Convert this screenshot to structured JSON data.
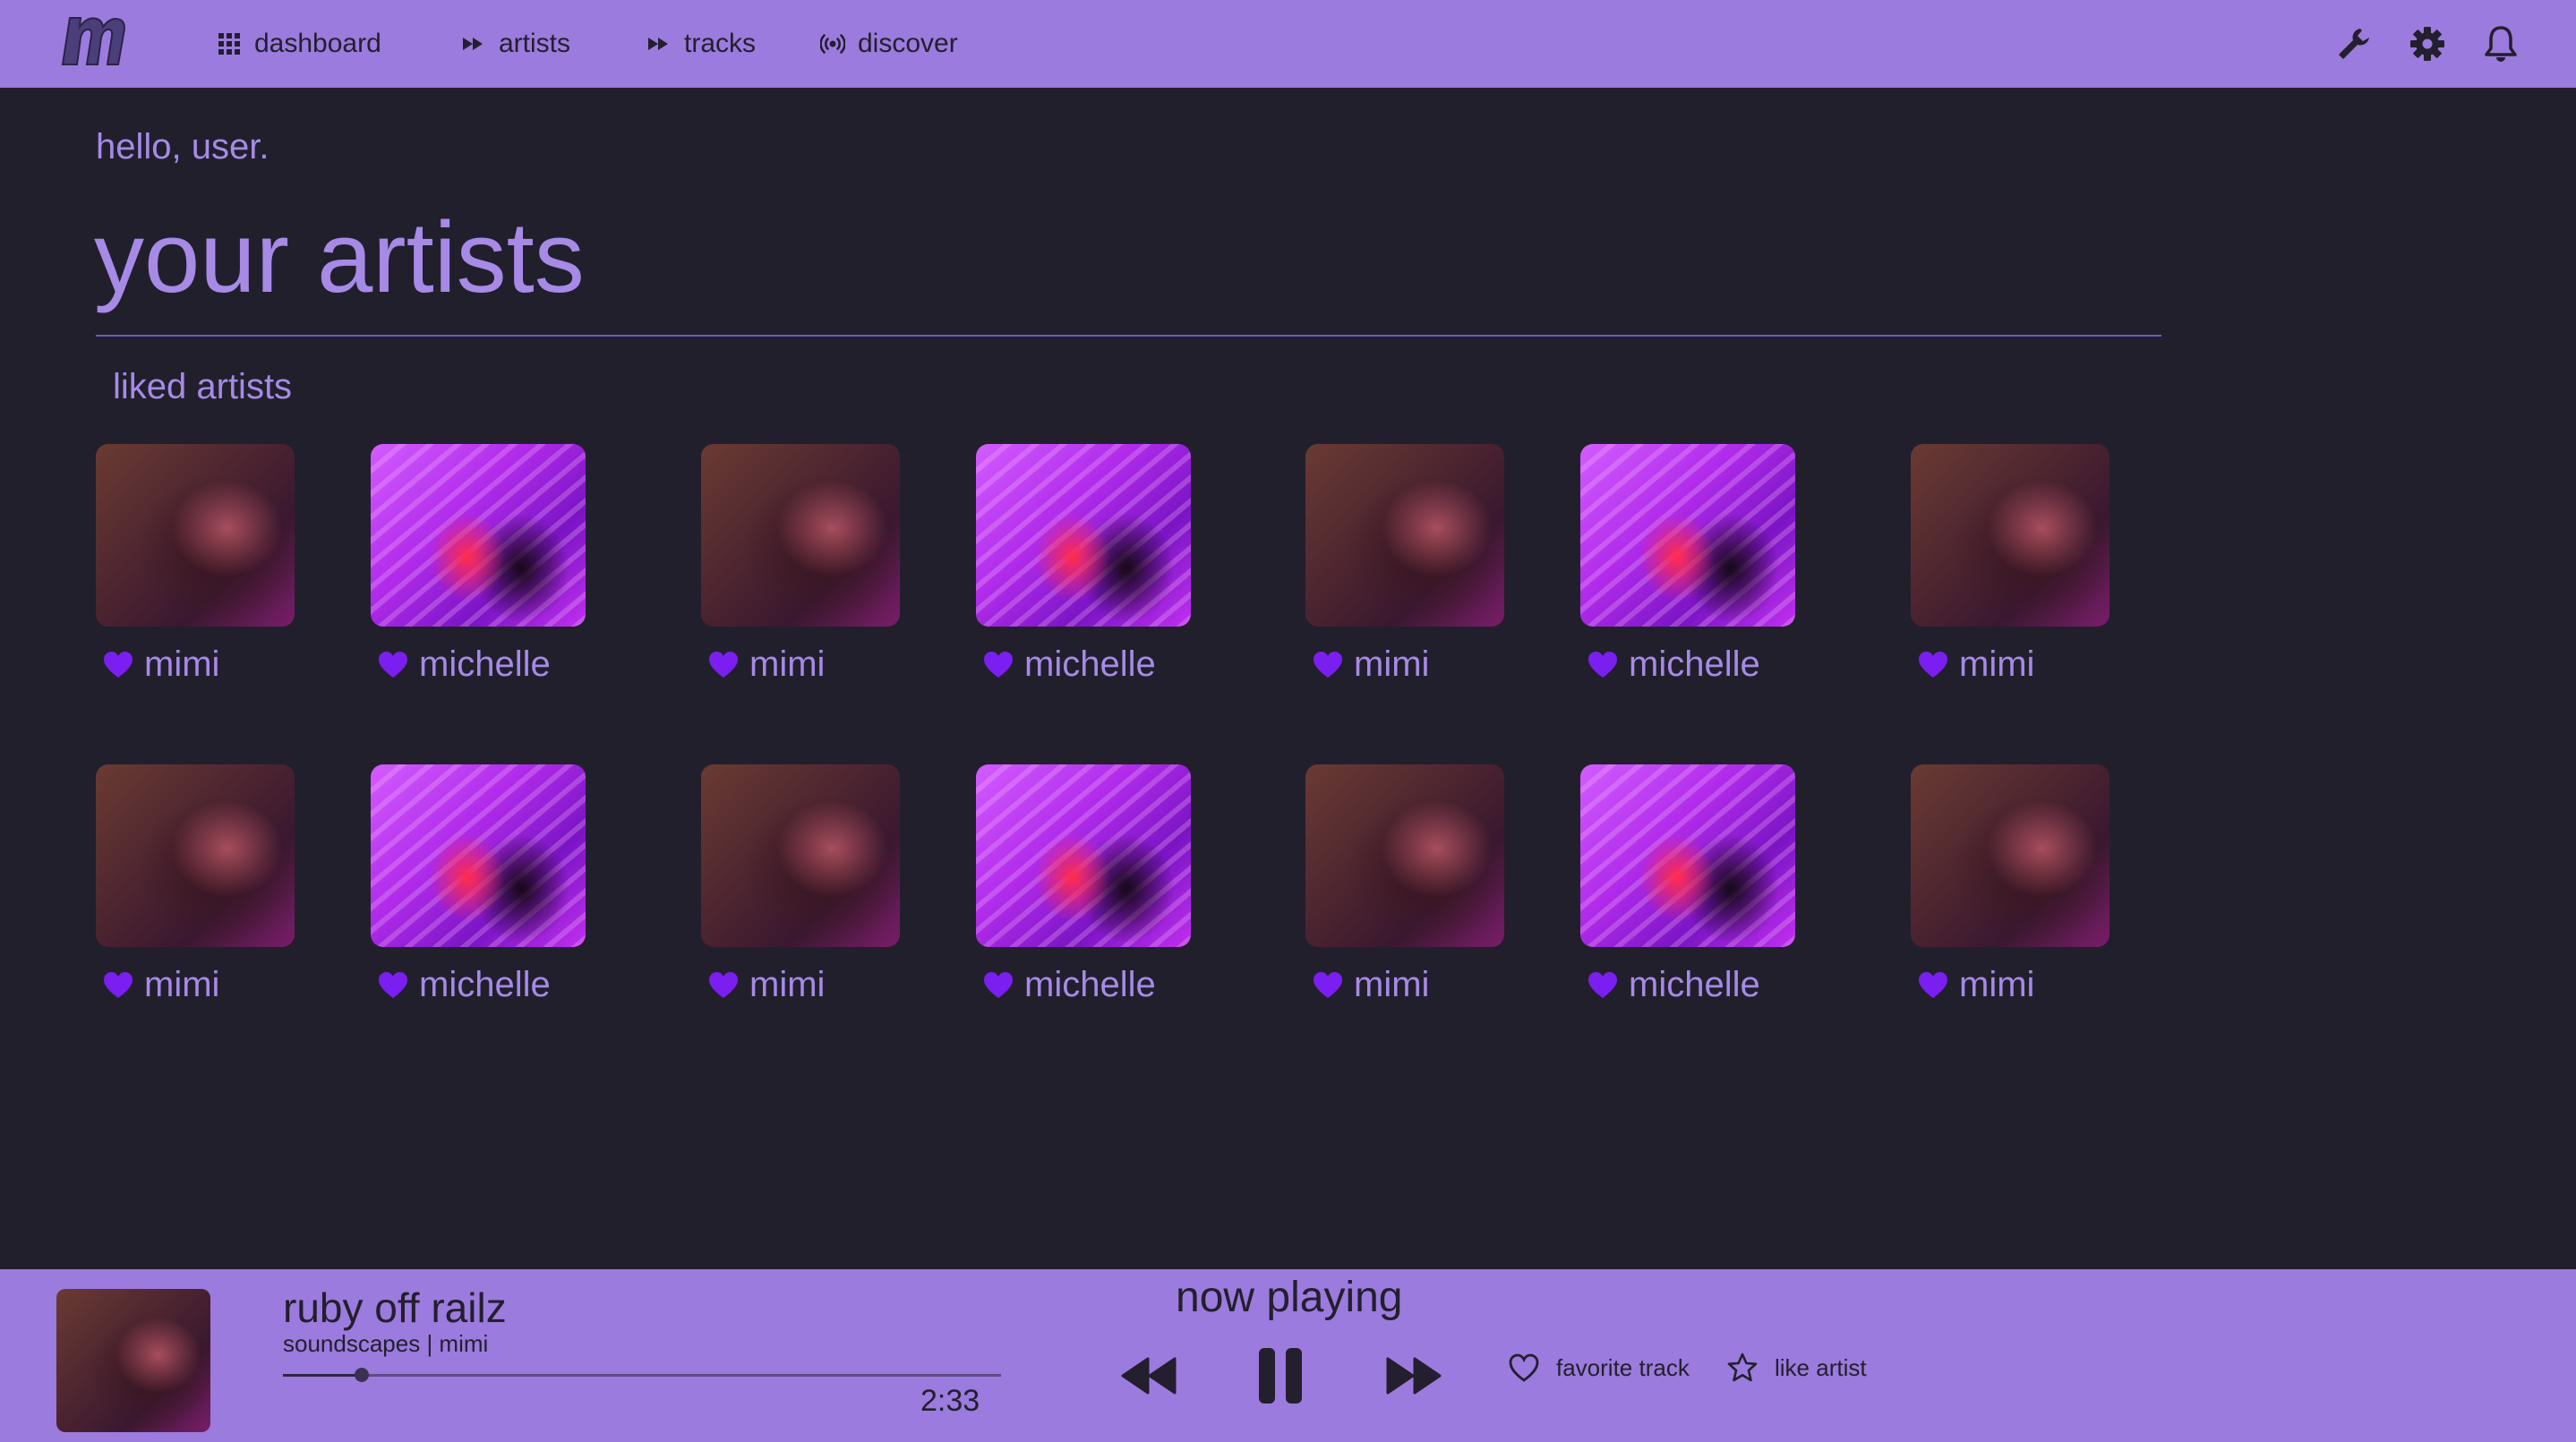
{
  "nav": {
    "items": [
      {
        "label": "dashboard",
        "icon": "grid-icon"
      },
      {
        "label": "artists",
        "icon": "fast-forward-icon"
      },
      {
        "label": "tracks",
        "icon": "fast-forward-icon"
      },
      {
        "label": "discover",
        "icon": "broadcast-icon"
      }
    ],
    "right_icons": [
      "wrench-icon",
      "gear-icon",
      "bell-icon"
    ]
  },
  "main": {
    "greeting": "hello, user.",
    "title": "your artists",
    "section": "liked artists",
    "rows": [
      [
        "mimi",
        "michelle",
        "mimi",
        "michelle",
        "mimi",
        "michelle",
        "mimi"
      ],
      [
        "mimi",
        "michelle",
        "mimi",
        "michelle",
        "mimi",
        "michelle",
        "mimi"
      ]
    ]
  },
  "player": {
    "heading": "now playing",
    "track_title": "ruby off railz",
    "track_sub": "soundscapes | mimi",
    "time": "2:33",
    "progress": 0.11,
    "favorite_label": "favorite track",
    "like_label": "like artist"
  },
  "colors": {
    "accent": "#9b7bdd",
    "background": "#221f2d",
    "text_accent": "#a68ae6",
    "heart": "#7a1ff0"
  }
}
